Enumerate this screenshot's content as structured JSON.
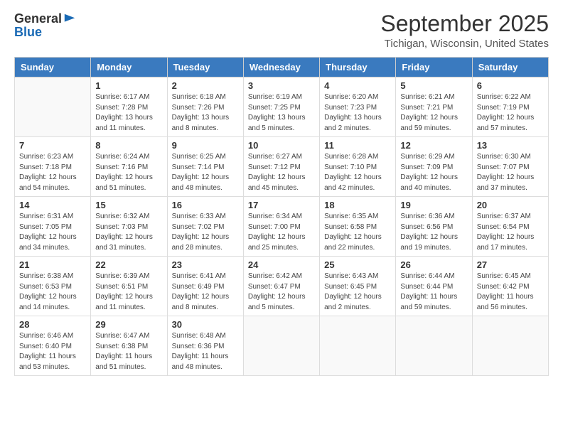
{
  "logo": {
    "general": "General",
    "blue": "Blue"
  },
  "title": "September 2025",
  "location": "Tichigan, Wisconsin, United States",
  "days_of_week": [
    "Sunday",
    "Monday",
    "Tuesday",
    "Wednesday",
    "Thursday",
    "Friday",
    "Saturday"
  ],
  "weeks": [
    [
      {
        "day": "",
        "sunrise": "",
        "sunset": "",
        "daylight": ""
      },
      {
        "day": "1",
        "sunrise": "Sunrise: 6:17 AM",
        "sunset": "Sunset: 7:28 PM",
        "daylight": "Daylight: 13 hours and 11 minutes."
      },
      {
        "day": "2",
        "sunrise": "Sunrise: 6:18 AM",
        "sunset": "Sunset: 7:26 PM",
        "daylight": "Daylight: 13 hours and 8 minutes."
      },
      {
        "day": "3",
        "sunrise": "Sunrise: 6:19 AM",
        "sunset": "Sunset: 7:25 PM",
        "daylight": "Daylight: 13 hours and 5 minutes."
      },
      {
        "day": "4",
        "sunrise": "Sunrise: 6:20 AM",
        "sunset": "Sunset: 7:23 PM",
        "daylight": "Daylight: 13 hours and 2 minutes."
      },
      {
        "day": "5",
        "sunrise": "Sunrise: 6:21 AM",
        "sunset": "Sunset: 7:21 PM",
        "daylight": "Daylight: 12 hours and 59 minutes."
      },
      {
        "day": "6",
        "sunrise": "Sunrise: 6:22 AM",
        "sunset": "Sunset: 7:19 PM",
        "daylight": "Daylight: 12 hours and 57 minutes."
      }
    ],
    [
      {
        "day": "7",
        "sunrise": "Sunrise: 6:23 AM",
        "sunset": "Sunset: 7:18 PM",
        "daylight": "Daylight: 12 hours and 54 minutes."
      },
      {
        "day": "8",
        "sunrise": "Sunrise: 6:24 AM",
        "sunset": "Sunset: 7:16 PM",
        "daylight": "Daylight: 12 hours and 51 minutes."
      },
      {
        "day": "9",
        "sunrise": "Sunrise: 6:25 AM",
        "sunset": "Sunset: 7:14 PM",
        "daylight": "Daylight: 12 hours and 48 minutes."
      },
      {
        "day": "10",
        "sunrise": "Sunrise: 6:27 AM",
        "sunset": "Sunset: 7:12 PM",
        "daylight": "Daylight: 12 hours and 45 minutes."
      },
      {
        "day": "11",
        "sunrise": "Sunrise: 6:28 AM",
        "sunset": "Sunset: 7:10 PM",
        "daylight": "Daylight: 12 hours and 42 minutes."
      },
      {
        "day": "12",
        "sunrise": "Sunrise: 6:29 AM",
        "sunset": "Sunset: 7:09 PM",
        "daylight": "Daylight: 12 hours and 40 minutes."
      },
      {
        "day": "13",
        "sunrise": "Sunrise: 6:30 AM",
        "sunset": "Sunset: 7:07 PM",
        "daylight": "Daylight: 12 hours and 37 minutes."
      }
    ],
    [
      {
        "day": "14",
        "sunrise": "Sunrise: 6:31 AM",
        "sunset": "Sunset: 7:05 PM",
        "daylight": "Daylight: 12 hours and 34 minutes."
      },
      {
        "day": "15",
        "sunrise": "Sunrise: 6:32 AM",
        "sunset": "Sunset: 7:03 PM",
        "daylight": "Daylight: 12 hours and 31 minutes."
      },
      {
        "day": "16",
        "sunrise": "Sunrise: 6:33 AM",
        "sunset": "Sunset: 7:02 PM",
        "daylight": "Daylight: 12 hours and 28 minutes."
      },
      {
        "day": "17",
        "sunrise": "Sunrise: 6:34 AM",
        "sunset": "Sunset: 7:00 PM",
        "daylight": "Daylight: 12 hours and 25 minutes."
      },
      {
        "day": "18",
        "sunrise": "Sunrise: 6:35 AM",
        "sunset": "Sunset: 6:58 PM",
        "daylight": "Daylight: 12 hours and 22 minutes."
      },
      {
        "day": "19",
        "sunrise": "Sunrise: 6:36 AM",
        "sunset": "Sunset: 6:56 PM",
        "daylight": "Daylight: 12 hours and 19 minutes."
      },
      {
        "day": "20",
        "sunrise": "Sunrise: 6:37 AM",
        "sunset": "Sunset: 6:54 PM",
        "daylight": "Daylight: 12 hours and 17 minutes."
      }
    ],
    [
      {
        "day": "21",
        "sunrise": "Sunrise: 6:38 AM",
        "sunset": "Sunset: 6:53 PM",
        "daylight": "Daylight: 12 hours and 14 minutes."
      },
      {
        "day": "22",
        "sunrise": "Sunrise: 6:39 AM",
        "sunset": "Sunset: 6:51 PM",
        "daylight": "Daylight: 12 hours and 11 minutes."
      },
      {
        "day": "23",
        "sunrise": "Sunrise: 6:41 AM",
        "sunset": "Sunset: 6:49 PM",
        "daylight": "Daylight: 12 hours and 8 minutes."
      },
      {
        "day": "24",
        "sunrise": "Sunrise: 6:42 AM",
        "sunset": "Sunset: 6:47 PM",
        "daylight": "Daylight: 12 hours and 5 minutes."
      },
      {
        "day": "25",
        "sunrise": "Sunrise: 6:43 AM",
        "sunset": "Sunset: 6:45 PM",
        "daylight": "Daylight: 12 hours and 2 minutes."
      },
      {
        "day": "26",
        "sunrise": "Sunrise: 6:44 AM",
        "sunset": "Sunset: 6:44 PM",
        "daylight": "Daylight: 11 hours and 59 minutes."
      },
      {
        "day": "27",
        "sunrise": "Sunrise: 6:45 AM",
        "sunset": "Sunset: 6:42 PM",
        "daylight": "Daylight: 11 hours and 56 minutes."
      }
    ],
    [
      {
        "day": "28",
        "sunrise": "Sunrise: 6:46 AM",
        "sunset": "Sunset: 6:40 PM",
        "daylight": "Daylight: 11 hours and 53 minutes."
      },
      {
        "day": "29",
        "sunrise": "Sunrise: 6:47 AM",
        "sunset": "Sunset: 6:38 PM",
        "daylight": "Daylight: 11 hours and 51 minutes."
      },
      {
        "day": "30",
        "sunrise": "Sunrise: 6:48 AM",
        "sunset": "Sunset: 6:36 PM",
        "daylight": "Daylight: 11 hours and 48 minutes."
      },
      {
        "day": "",
        "sunrise": "",
        "sunset": "",
        "daylight": ""
      },
      {
        "day": "",
        "sunrise": "",
        "sunset": "",
        "daylight": ""
      },
      {
        "day": "",
        "sunrise": "",
        "sunset": "",
        "daylight": ""
      },
      {
        "day": "",
        "sunrise": "",
        "sunset": "",
        "daylight": ""
      }
    ]
  ]
}
